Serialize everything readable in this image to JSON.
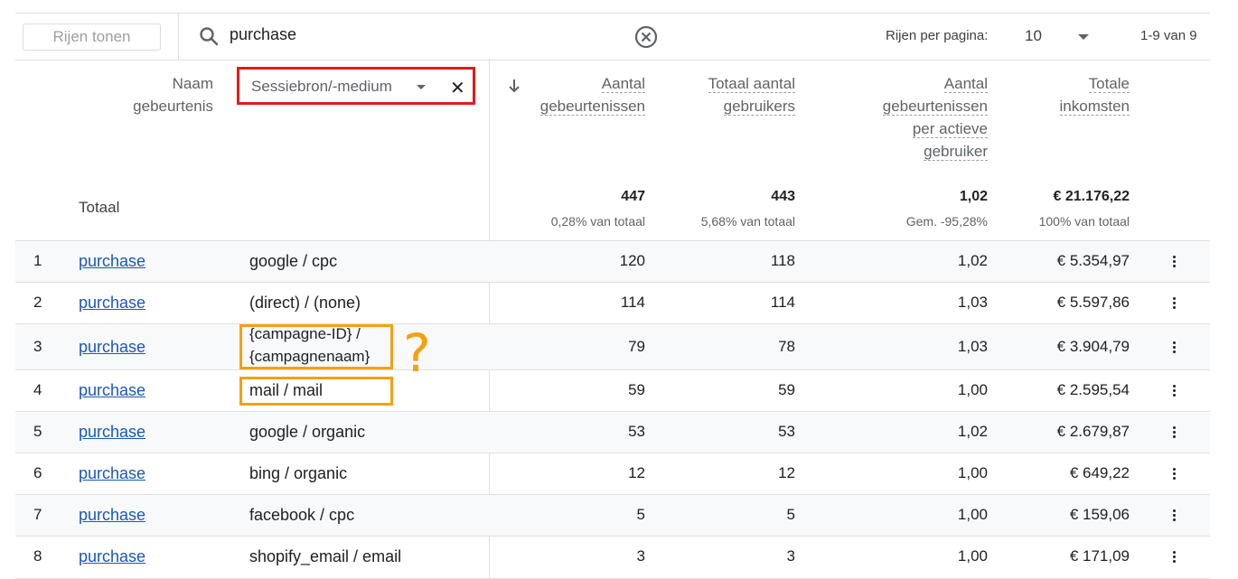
{
  "toolbar": {
    "rows_button": "Rijen tonen",
    "search_value": "purchase",
    "rows_per_page_label": "Rijen per pagina:",
    "rows_per_page_value": "10",
    "page_range": "1-9 van 9"
  },
  "header": {
    "event_name": [
      "Naam",
      "gebeurtenis"
    ],
    "dimension_select": "Sessiebron/-medium",
    "col_events": [
      "Aantal",
      "gebeurtenissen"
    ],
    "col_users": [
      "Totaal aantal",
      "gebruikers"
    ],
    "col_per_user": [
      "Aantal",
      "gebeurtenissen",
      "per actieve",
      "gebruiker"
    ],
    "col_revenue": [
      "Totale",
      "inkomsten"
    ]
  },
  "totals": {
    "label": "Totaal",
    "events": "447",
    "events_sub": "0,28% van totaal",
    "users": "443",
    "users_sub": "5,68% van totaal",
    "per_user": "1,02",
    "per_user_sub": "Gem. -95,28%",
    "revenue": "€ 21.176,22",
    "revenue_sub": "100% van totaal"
  },
  "rows": [
    {
      "idx": "1",
      "event": "purchase",
      "source": "google / cpc",
      "events": "120",
      "users": "118",
      "per_user": "1,02",
      "revenue": "€ 5.354,97"
    },
    {
      "idx": "2",
      "event": "purchase",
      "source": "(direct) / (none)",
      "events": "114",
      "users": "114",
      "per_user": "1,03",
      "revenue": "€ 5.597,86"
    },
    {
      "idx": "3",
      "event": "purchase",
      "source": "{campagne-ID} /",
      "source2": "{campagnenaam}",
      "events": "79",
      "users": "78",
      "per_user": "1,03",
      "revenue": "€ 3.904,79"
    },
    {
      "idx": "4",
      "event": "purchase",
      "source": "mail / mail",
      "events": "59",
      "users": "59",
      "per_user": "1,00",
      "revenue": "€ 2.595,54"
    },
    {
      "idx": "5",
      "event": "purchase",
      "source": "google / organic",
      "events": "53",
      "users": "53",
      "per_user": "1,02",
      "revenue": "€ 2.679,87"
    },
    {
      "idx": "6",
      "event": "purchase",
      "source": "bing / organic",
      "events": "12",
      "users": "12",
      "per_user": "1,00",
      "revenue": "€ 649,22"
    },
    {
      "idx": "7",
      "event": "purchase",
      "source": "facebook / cpc",
      "events": "5",
      "users": "5",
      "per_user": "1,00",
      "revenue": "€ 159,06"
    },
    {
      "idx": "8",
      "event": "purchase",
      "source": "shopify_email / email",
      "events": "3",
      "users": "3",
      "per_user": "1,00",
      "revenue": "€ 171,09"
    }
  ],
  "annotation": {
    "question_mark": "?"
  },
  "colors": {
    "highlight_red": "#e21b1b",
    "highlight_orange": "#f5a00f",
    "link": "#1a57b8"
  }
}
